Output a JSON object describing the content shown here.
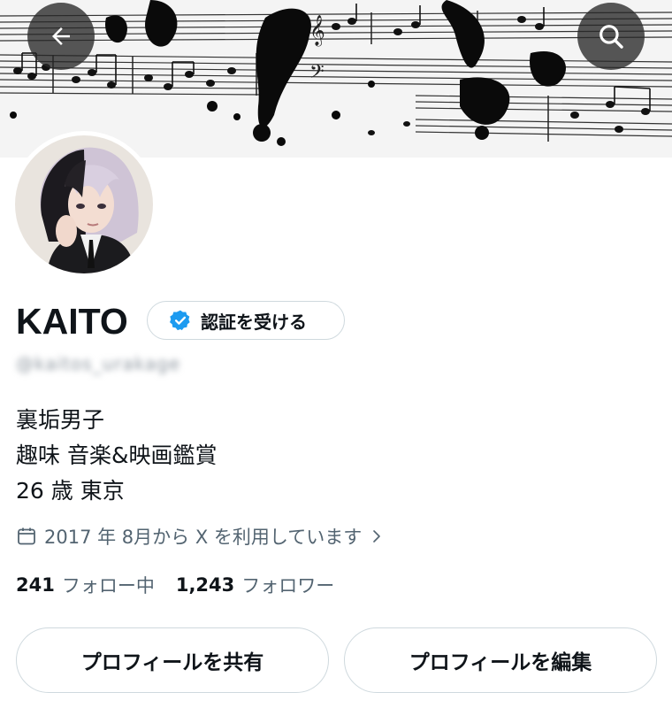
{
  "profile": {
    "display_name": "KAITO",
    "verify_label": "認証を受ける",
    "handle": "@kaitos_urakage",
    "bio_lines": [
      "裏垢男子",
      "趣味 音楽&映画鑑賞",
      "26 歳 東京"
    ],
    "joined": "2017 年 8月から X を利用しています"
  },
  "stats": {
    "following_count": "241",
    "following_label": "フォロー中",
    "followers_count": "1,243",
    "followers_label": "フォロワー"
  },
  "actions": {
    "share_label": "プロフィールを共有",
    "edit_label": "プロフィールを編集"
  },
  "icons": {
    "back": "arrow-left-icon",
    "search": "search-icon",
    "verified": "verified-badge-icon",
    "calendar": "calendar-icon",
    "chevron": "chevron-right-icon"
  },
  "colors": {
    "text_primary": "#0f1419",
    "text_secondary": "#536471",
    "border": "#cfd9de",
    "verified_blue": "#1d9bf0",
    "overlay_button": "#282828"
  }
}
